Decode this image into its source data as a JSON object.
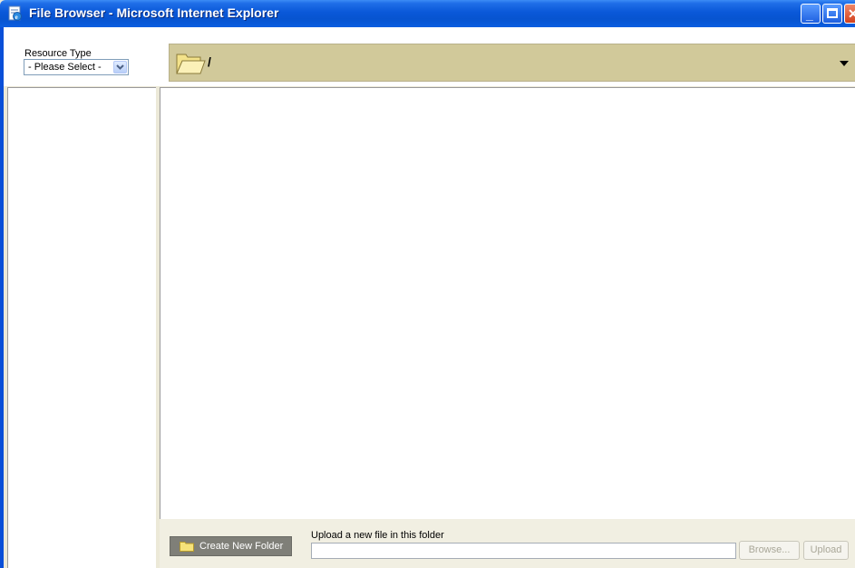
{
  "window": {
    "title": "File Browser - Microsoft Internet Explorer",
    "icon": "ie-page-icon",
    "controls": [
      "minimize-icon",
      "maximize-icon",
      "close-icon"
    ]
  },
  "resource": {
    "label": "Resource Type",
    "selected": "- Please Select -"
  },
  "pathbar": {
    "path": "/",
    "folder_icon": "folder-open-icon",
    "dropdown_icon": "triangle-down-icon"
  },
  "tree": {
    "items": []
  },
  "files": {
    "items": []
  },
  "bottom": {
    "create_folder_label": "Create New Folder",
    "upload_label": "Upload a new file in this folder",
    "upload_value": "",
    "browse_label": "Browse...",
    "upload_button_label": "Upload"
  },
  "colors": {
    "titlebar": "#0a58d8",
    "pathbar": "#d1c99a",
    "bottom_bar": "#f1efe2",
    "create_button": "#7f7f78"
  }
}
